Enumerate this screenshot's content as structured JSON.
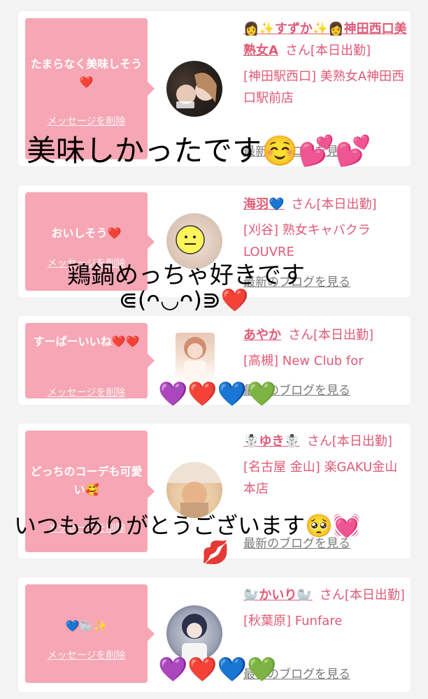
{
  "delete_label": "メッセージを削除",
  "blog_label": "最新のブログを見る",
  "honorific": "さん",
  "cards": [
    {
      "message": "たまらなく美味しそう❤️",
      "name": "👩✨すずか✨👩神田西口美熟女A",
      "status": "さん[本日出勤]",
      "shop": "[神田駅西口] 美熟女A神田西口駅前店"
    },
    {
      "message": "おいしそう❤️",
      "name": "海羽💙",
      "status": "さん[本日出勤]",
      "shop": "[刈谷] 熟女キャバクラLOUVRE"
    },
    {
      "message": "すーぱーいいね❤️❤️",
      "name": "あやか",
      "status": "さん[本日出勤]",
      "shop": "[高槻] New Club for"
    },
    {
      "message": "どっちのコーデも可愛い🥰",
      "name": "☃️ゆき☃️",
      "status": "さん[本日出勤]",
      "shop": "[名古屋 金山] 楽GAKU金山本店"
    },
    {
      "message": "💙🦭✨",
      "name": "🦭かいり🦭",
      "status": "さん[本日出勤]",
      "shop": "[秋葉原] Funfare"
    }
  ],
  "overlays": {
    "text1": "美味しかったです☺️💕💕",
    "text2": "鶏鍋めっちゃ好きです",
    "text2b": "⋐(ᴖ◡ᴖ)⋑❤️",
    "text3": "いつもありがとうございます🥺💓",
    "lips": "💋",
    "hearts_row_a": "💜❤️💙💚",
    "hearts_row_b": "💜❤️💙💚"
  }
}
